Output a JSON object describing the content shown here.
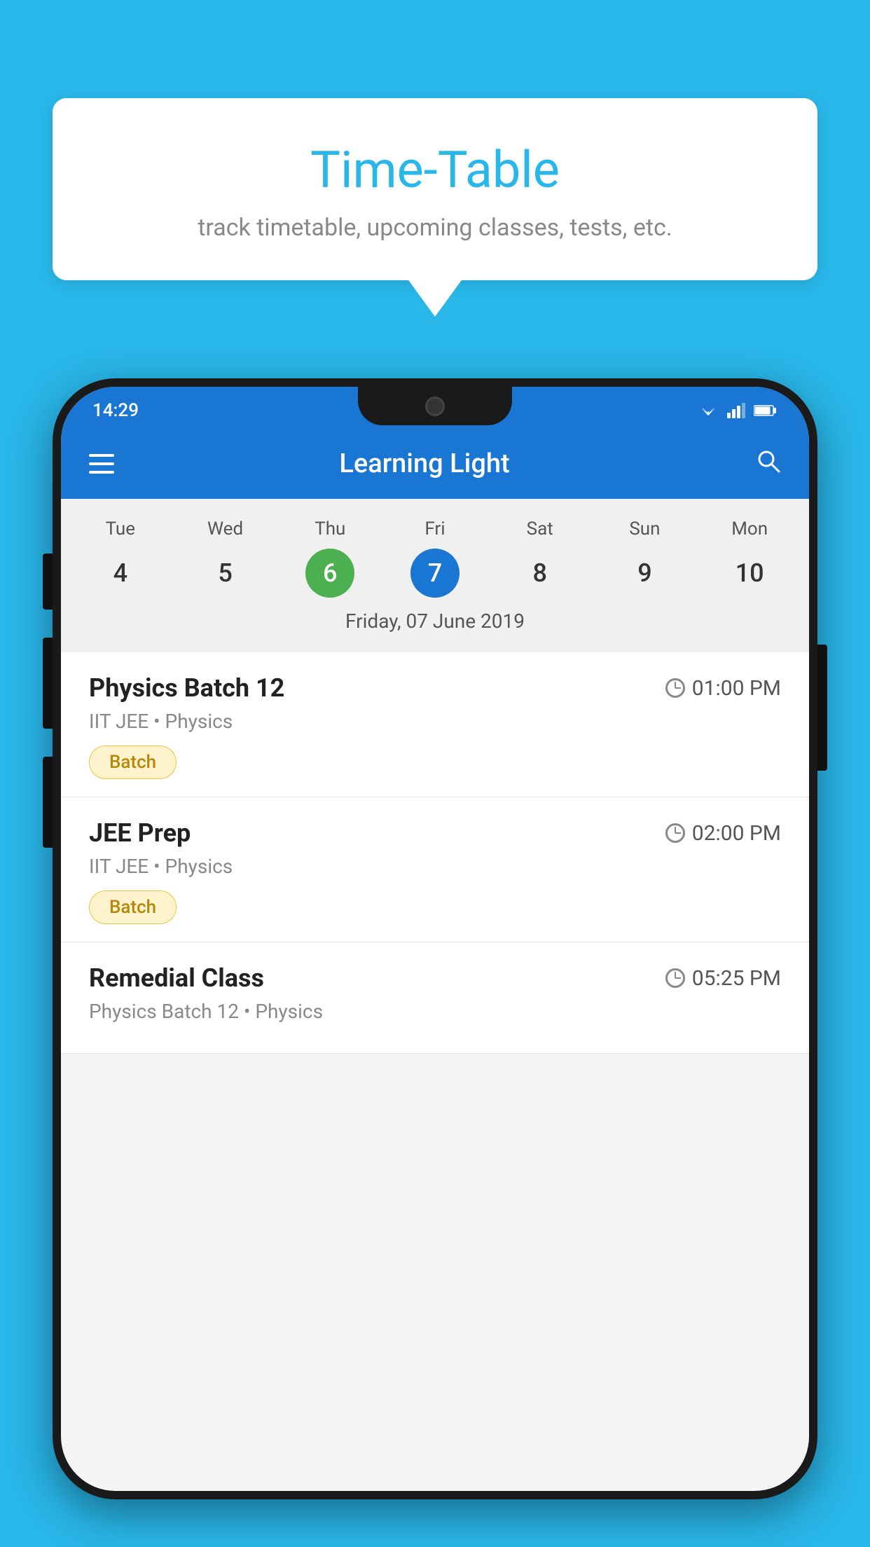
{
  "background_color": "#29B6E8",
  "bubble": {
    "title": "Time-Table",
    "subtitle": "track timetable, upcoming classes, tests, etc."
  },
  "phone": {
    "status_bar": {
      "time": "14:29"
    },
    "app_bar": {
      "title": "Learning Light"
    },
    "calendar": {
      "days": [
        "Tue",
        "Wed",
        "Thu",
        "Fri",
        "Sat",
        "Sun",
        "Mon"
      ],
      "dates": [
        4,
        5,
        6,
        7,
        8,
        9,
        10
      ],
      "today_index": 2,
      "selected_index": 3,
      "selected_label": "Friday, 07 June 2019"
    },
    "schedule": [
      {
        "title": "Physics Batch 12",
        "time": "01:00 PM",
        "subtitle": "IIT JEE • Physics",
        "tag": "Batch"
      },
      {
        "title": "JEE Prep",
        "time": "02:00 PM",
        "subtitle": "IIT JEE • Physics",
        "tag": "Batch"
      },
      {
        "title": "Remedial Class",
        "time": "05:25 PM",
        "subtitle": "Physics Batch 12 • Physics",
        "tag": ""
      }
    ]
  }
}
